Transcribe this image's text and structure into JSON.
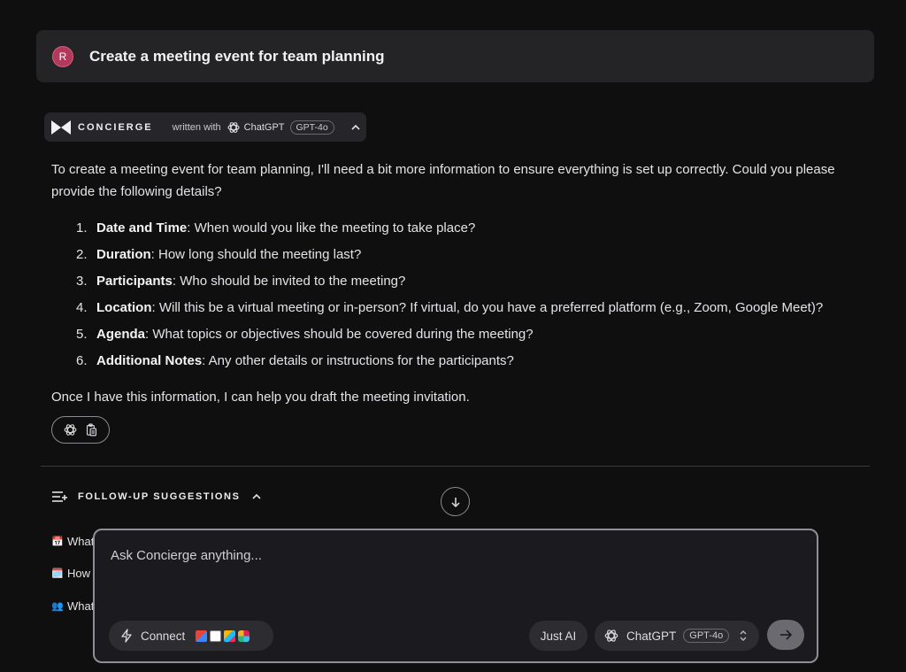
{
  "header": {
    "avatar_initial": "R",
    "title": "Create a meeting event for team planning"
  },
  "concierge": {
    "name": "CONCIERGE",
    "written_with": "written with",
    "model_provider": "ChatGPT",
    "model_badge": "GPT-4o"
  },
  "response": {
    "intro": "To create a meeting event for team planning, I'll need a bit more information to ensure everything is set up correctly. Could you please provide the following details?",
    "steps": [
      {
        "num": "1.",
        "label": "Date and Time",
        "text": ": When would you like the meeting to take place?"
      },
      {
        "num": "2.",
        "label": "Duration",
        "text": ": How long should the meeting last?"
      },
      {
        "num": "3.",
        "label": "Participants",
        "text": ": Who should be invited to the meeting?"
      },
      {
        "num": "4.",
        "label": "Location",
        "text": ": Will this be a virtual meeting or in-person? If virtual, do you have a preferred platform (e.g., Zoom, Google Meet)?"
      },
      {
        "num": "5.",
        "label": "Agenda",
        "text": ": What topics or objectives should be covered during the meeting?"
      },
      {
        "num": "6.",
        "label": "Additional Notes",
        "text": ": Any other details or instructions for the participants?"
      }
    ],
    "closing": "Once I have this information, I can help you draft the meeting invitation."
  },
  "followup": {
    "title": "FOLLOW-UP SUGGESTIONS",
    "items": [
      {
        "emoji": "📅",
        "text": "What"
      },
      {
        "emoji": "🗓️",
        "text": "How"
      },
      {
        "emoji": "👥",
        "text": "What"
      }
    ]
  },
  "composer": {
    "placeholder": "Ask Concierge anything...",
    "connect_label": "Connect",
    "just_ai_label": "Just AI",
    "model_provider": "ChatGPT",
    "model_badge": "GPT-4o"
  },
  "colors": {
    "background": "#0f0f10",
    "card": "#242427",
    "avatar": "#b3395c",
    "composer_border": "#8e8e98"
  }
}
